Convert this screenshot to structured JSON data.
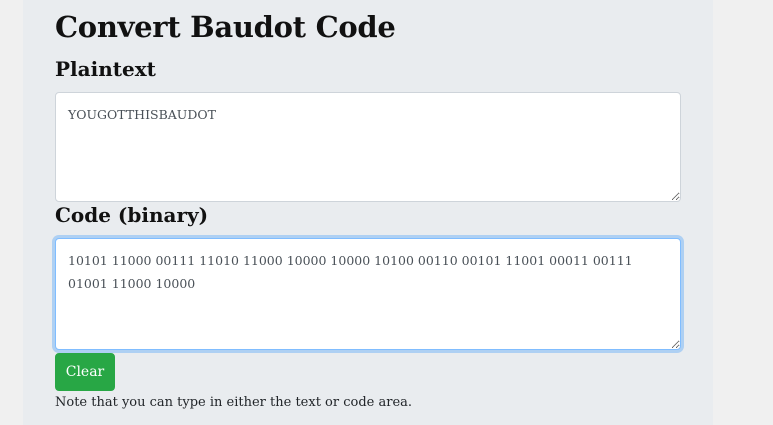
{
  "page": {
    "title": "Convert Baudot Code"
  },
  "plaintext": {
    "label": "Plaintext",
    "value": "YOUGOTTHISBAUDOT"
  },
  "code": {
    "label": "Code (binary)",
    "value": "10101 11000 00111 11010 11000 10000 10000 10100 00110 00101 11001 00011 00111 01001 11000 10000"
  },
  "actions": {
    "clear_label": "Clear"
  },
  "note": "Note that you can type in either the text or code area.",
  "colors": {
    "clear_button": "#28a745",
    "panel_background": "#e9ecef",
    "focus_border": "#80bdff"
  }
}
